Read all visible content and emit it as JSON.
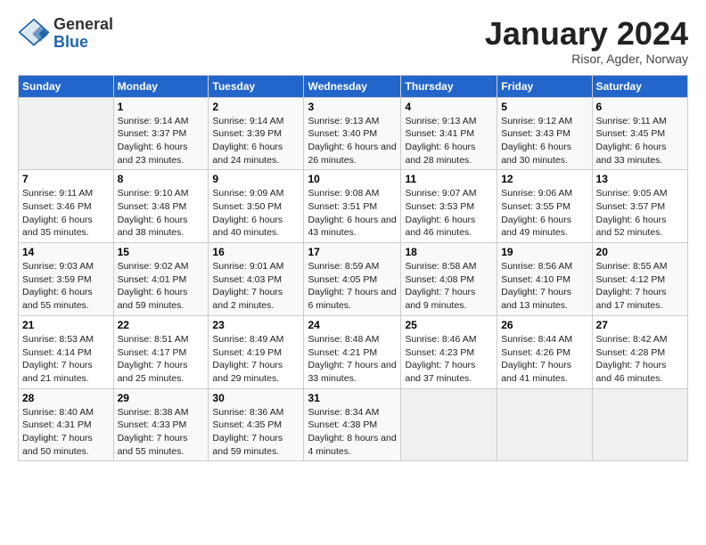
{
  "logo": {
    "general": "General",
    "blue": "Blue"
  },
  "title": "January 2024",
  "subtitle": "Risor, Agder, Norway",
  "days_header": [
    "Sunday",
    "Monday",
    "Tuesday",
    "Wednesday",
    "Thursday",
    "Friday",
    "Saturday"
  ],
  "weeks": [
    [
      {
        "day": "",
        "sunrise": "",
        "sunset": "",
        "daylight": ""
      },
      {
        "day": "1",
        "sunrise": "Sunrise: 9:14 AM",
        "sunset": "Sunset: 3:37 PM",
        "daylight": "Daylight: 6 hours and 23 minutes."
      },
      {
        "day": "2",
        "sunrise": "Sunrise: 9:14 AM",
        "sunset": "Sunset: 3:39 PM",
        "daylight": "Daylight: 6 hours and 24 minutes."
      },
      {
        "day": "3",
        "sunrise": "Sunrise: 9:13 AM",
        "sunset": "Sunset: 3:40 PM",
        "daylight": "Daylight: 6 hours and 26 minutes."
      },
      {
        "day": "4",
        "sunrise": "Sunrise: 9:13 AM",
        "sunset": "Sunset: 3:41 PM",
        "daylight": "Daylight: 6 hours and 28 minutes."
      },
      {
        "day": "5",
        "sunrise": "Sunrise: 9:12 AM",
        "sunset": "Sunset: 3:43 PM",
        "daylight": "Daylight: 6 hours and 30 minutes."
      },
      {
        "day": "6",
        "sunrise": "Sunrise: 9:11 AM",
        "sunset": "Sunset: 3:45 PM",
        "daylight": "Daylight: 6 hours and 33 minutes."
      }
    ],
    [
      {
        "day": "7",
        "sunrise": "Sunrise: 9:11 AM",
        "sunset": "Sunset: 3:46 PM",
        "daylight": "Daylight: 6 hours and 35 minutes."
      },
      {
        "day": "8",
        "sunrise": "Sunrise: 9:10 AM",
        "sunset": "Sunset: 3:48 PM",
        "daylight": "Daylight: 6 hours and 38 minutes."
      },
      {
        "day": "9",
        "sunrise": "Sunrise: 9:09 AM",
        "sunset": "Sunset: 3:50 PM",
        "daylight": "Daylight: 6 hours and 40 minutes."
      },
      {
        "day": "10",
        "sunrise": "Sunrise: 9:08 AM",
        "sunset": "Sunset: 3:51 PM",
        "daylight": "Daylight: 6 hours and 43 minutes."
      },
      {
        "day": "11",
        "sunrise": "Sunrise: 9:07 AM",
        "sunset": "Sunset: 3:53 PM",
        "daylight": "Daylight: 6 hours and 46 minutes."
      },
      {
        "day": "12",
        "sunrise": "Sunrise: 9:06 AM",
        "sunset": "Sunset: 3:55 PM",
        "daylight": "Daylight: 6 hours and 49 minutes."
      },
      {
        "day": "13",
        "sunrise": "Sunrise: 9:05 AM",
        "sunset": "Sunset: 3:57 PM",
        "daylight": "Daylight: 6 hours and 52 minutes."
      }
    ],
    [
      {
        "day": "14",
        "sunrise": "Sunrise: 9:03 AM",
        "sunset": "Sunset: 3:59 PM",
        "daylight": "Daylight: 6 hours and 55 minutes."
      },
      {
        "day": "15",
        "sunrise": "Sunrise: 9:02 AM",
        "sunset": "Sunset: 4:01 PM",
        "daylight": "Daylight: 6 hours and 59 minutes."
      },
      {
        "day": "16",
        "sunrise": "Sunrise: 9:01 AM",
        "sunset": "Sunset: 4:03 PM",
        "daylight": "Daylight: 7 hours and 2 minutes."
      },
      {
        "day": "17",
        "sunrise": "Sunrise: 8:59 AM",
        "sunset": "Sunset: 4:05 PM",
        "daylight": "Daylight: 7 hours and 6 minutes."
      },
      {
        "day": "18",
        "sunrise": "Sunrise: 8:58 AM",
        "sunset": "Sunset: 4:08 PM",
        "daylight": "Daylight: 7 hours and 9 minutes."
      },
      {
        "day": "19",
        "sunrise": "Sunrise: 8:56 AM",
        "sunset": "Sunset: 4:10 PM",
        "daylight": "Daylight: 7 hours and 13 minutes."
      },
      {
        "day": "20",
        "sunrise": "Sunrise: 8:55 AM",
        "sunset": "Sunset: 4:12 PM",
        "daylight": "Daylight: 7 hours and 17 minutes."
      }
    ],
    [
      {
        "day": "21",
        "sunrise": "Sunrise: 8:53 AM",
        "sunset": "Sunset: 4:14 PM",
        "daylight": "Daylight: 7 hours and 21 minutes."
      },
      {
        "day": "22",
        "sunrise": "Sunrise: 8:51 AM",
        "sunset": "Sunset: 4:17 PM",
        "daylight": "Daylight: 7 hours and 25 minutes."
      },
      {
        "day": "23",
        "sunrise": "Sunrise: 8:49 AM",
        "sunset": "Sunset: 4:19 PM",
        "daylight": "Daylight: 7 hours and 29 minutes."
      },
      {
        "day": "24",
        "sunrise": "Sunrise: 8:48 AM",
        "sunset": "Sunset: 4:21 PM",
        "daylight": "Daylight: 7 hours and 33 minutes."
      },
      {
        "day": "25",
        "sunrise": "Sunrise: 8:46 AM",
        "sunset": "Sunset: 4:23 PM",
        "daylight": "Daylight: 7 hours and 37 minutes."
      },
      {
        "day": "26",
        "sunrise": "Sunrise: 8:44 AM",
        "sunset": "Sunset: 4:26 PM",
        "daylight": "Daylight: 7 hours and 41 minutes."
      },
      {
        "day": "27",
        "sunrise": "Sunrise: 8:42 AM",
        "sunset": "Sunset: 4:28 PM",
        "daylight": "Daylight: 7 hours and 46 minutes."
      }
    ],
    [
      {
        "day": "28",
        "sunrise": "Sunrise: 8:40 AM",
        "sunset": "Sunset: 4:31 PM",
        "daylight": "Daylight: 7 hours and 50 minutes."
      },
      {
        "day": "29",
        "sunrise": "Sunrise: 8:38 AM",
        "sunset": "Sunset: 4:33 PM",
        "daylight": "Daylight: 7 hours and 55 minutes."
      },
      {
        "day": "30",
        "sunrise": "Sunrise: 8:36 AM",
        "sunset": "Sunset: 4:35 PM",
        "daylight": "Daylight: 7 hours and 59 minutes."
      },
      {
        "day": "31",
        "sunrise": "Sunrise: 8:34 AM",
        "sunset": "Sunset: 4:38 PM",
        "daylight": "Daylight: 8 hours and 4 minutes."
      },
      {
        "day": "",
        "sunrise": "",
        "sunset": "",
        "daylight": ""
      },
      {
        "day": "",
        "sunrise": "",
        "sunset": "",
        "daylight": ""
      },
      {
        "day": "",
        "sunrise": "",
        "sunset": "",
        "daylight": ""
      }
    ]
  ]
}
